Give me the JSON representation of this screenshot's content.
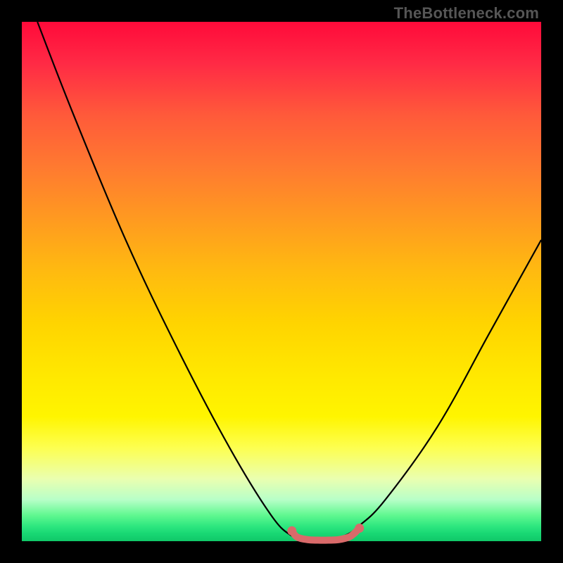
{
  "watermark": "TheBottleneck.com",
  "chart_data": {
    "type": "line",
    "title": "",
    "xlabel": "",
    "ylabel": "",
    "xlim": [
      0,
      100
    ],
    "ylim": [
      0,
      100
    ],
    "grid": false,
    "legend": false,
    "series": [
      {
        "name": "bottleneck-curve",
        "color": "#000000",
        "x": [
          3,
          10,
          20,
          30,
          40,
          48,
          52,
          55,
          58,
          62,
          65,
          70,
          80,
          90,
          100
        ],
        "y": [
          100,
          82,
          58,
          37,
          18,
          5,
          1,
          0,
          0,
          1,
          3,
          8,
          22,
          40,
          58
        ]
      },
      {
        "name": "optimal-range-marker",
        "color": "#e06666",
        "x": [
          52,
          53,
          55,
          57,
          59,
          61,
          63,
          64,
          65
        ],
        "y": [
          2.0,
          0.8,
          0.3,
          0.2,
          0.2,
          0.3,
          0.8,
          1.5,
          2.5
        ]
      }
    ],
    "background_gradient": {
      "top_color": "#ff0a3a",
      "bottom_color": "#10c868"
    }
  }
}
